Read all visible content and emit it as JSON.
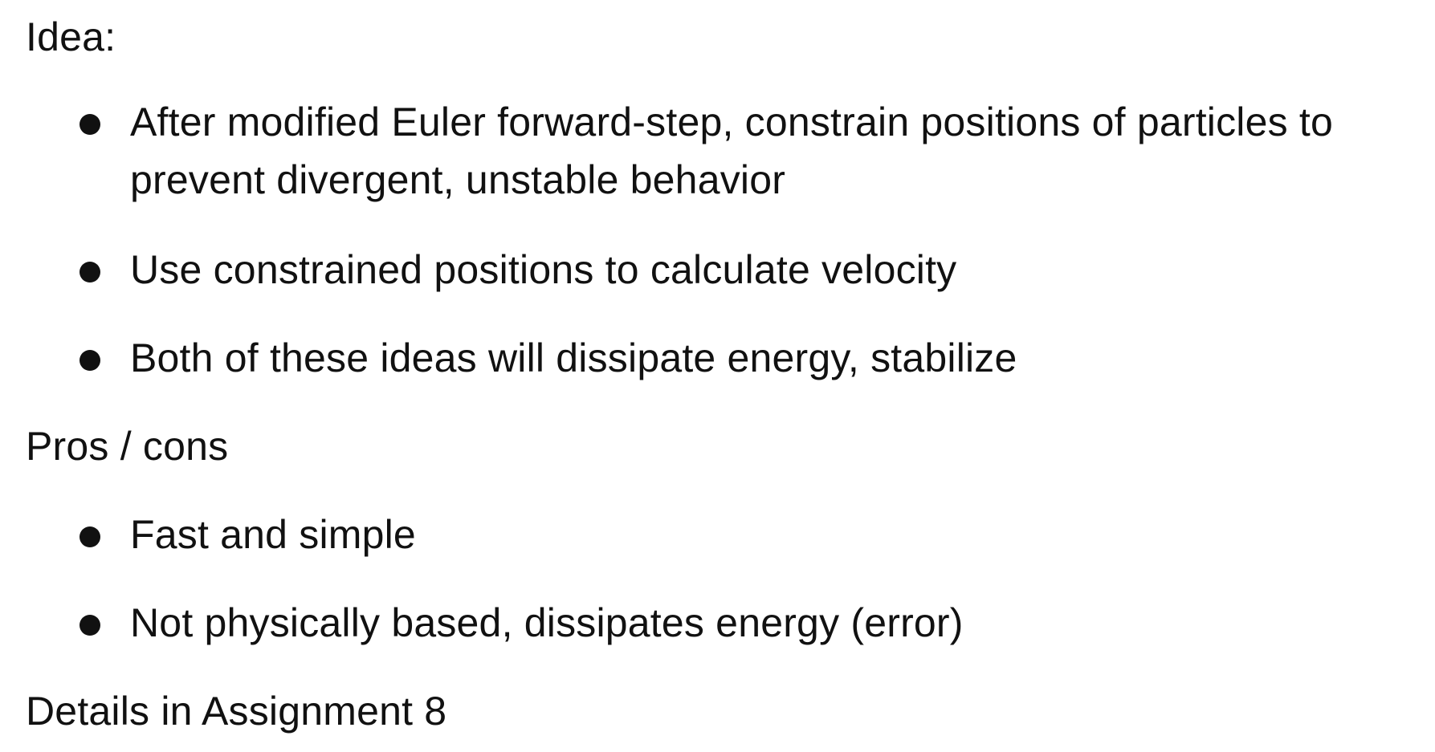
{
  "sections": [
    {
      "heading": "Idea:",
      "bullets": [
        "After modified Euler forward-step, constrain positions of particles to prevent divergent, unstable behavior",
        "Use constrained positions to calculate velocity",
        "Both of these ideas will dissipate energy, stabilize"
      ]
    },
    {
      "heading": "Pros / cons",
      "bullets": [
        "Fast and simple",
        "Not physically based, dissipates energy (error)"
      ]
    },
    {
      "heading": "Details in Assignment 8",
      "bullets": []
    }
  ]
}
